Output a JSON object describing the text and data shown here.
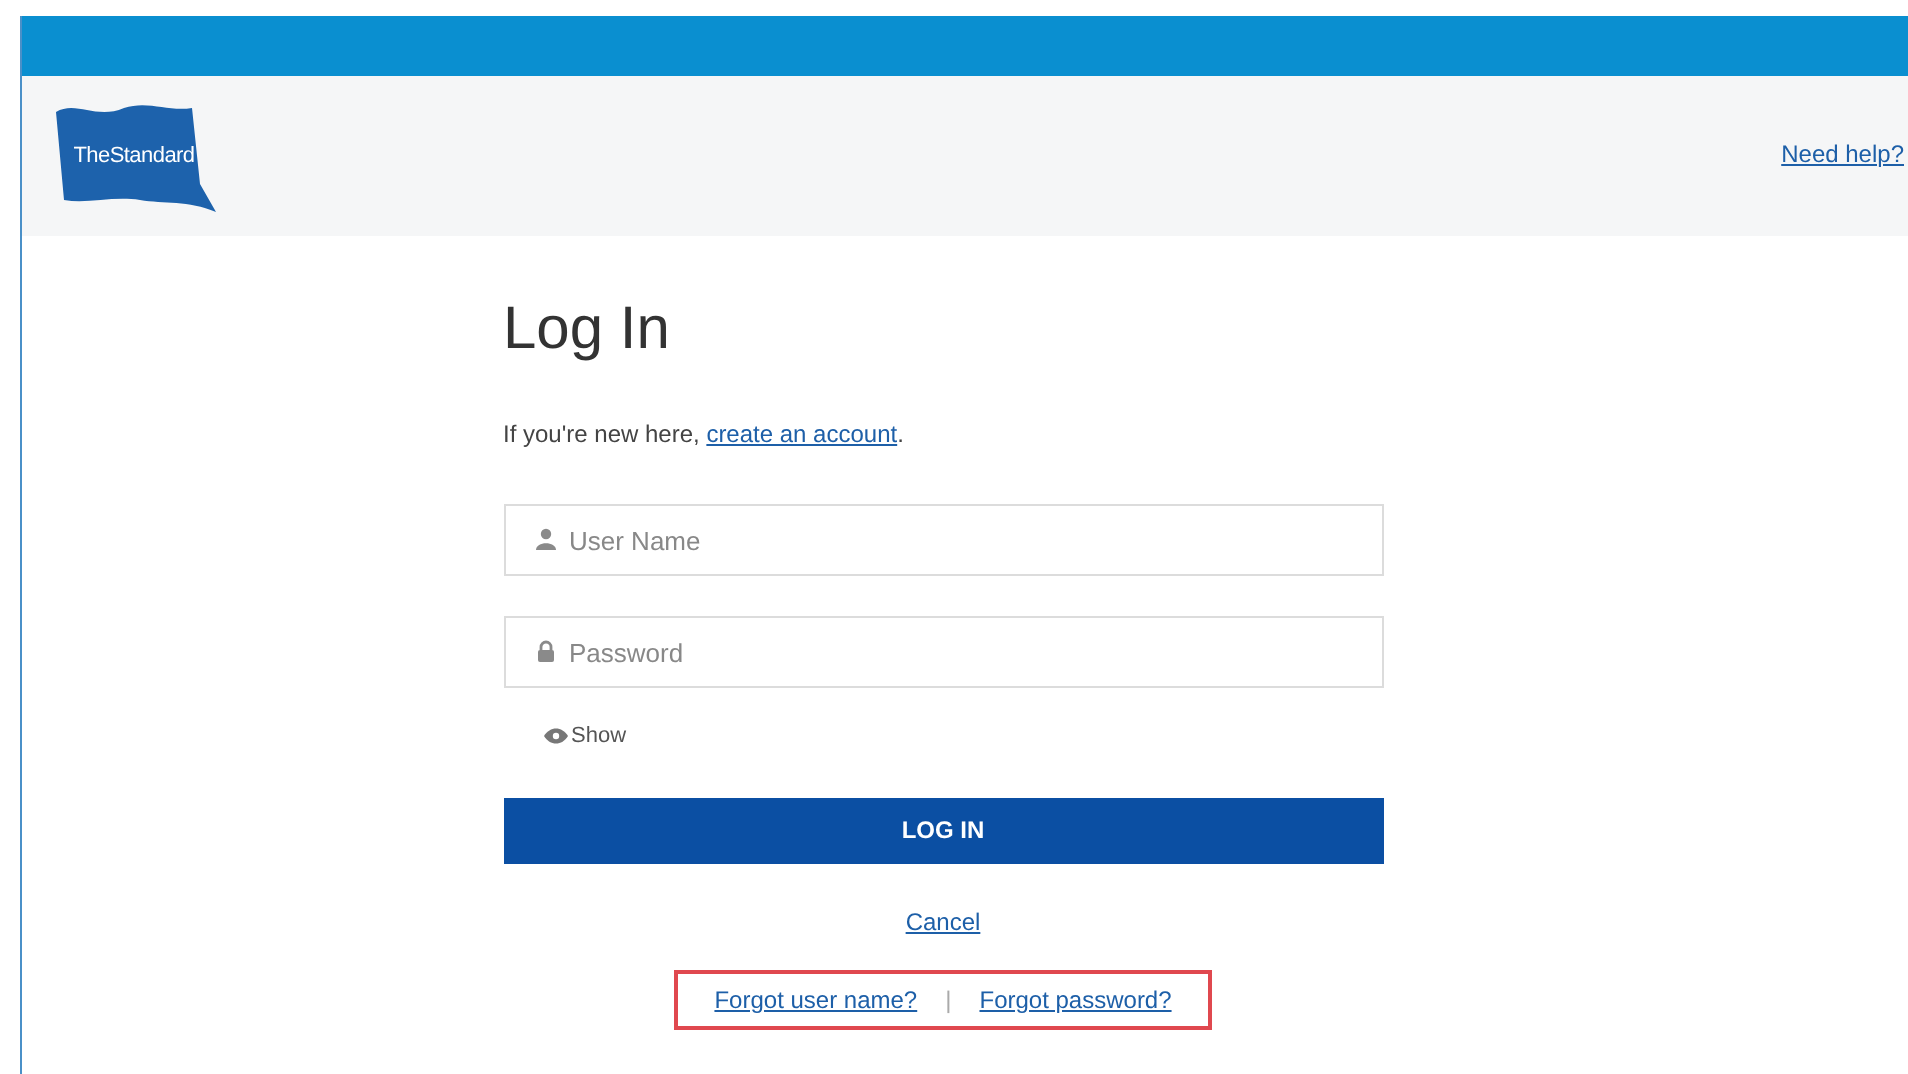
{
  "header": {
    "logo": "TheStandard",
    "help_link": "Need help?"
  },
  "login": {
    "title": "Log In",
    "intro": {
      "text": "If you're new here, ",
      "link": "create an account",
      "end": "."
    },
    "fields": [
      {
        "kind": "user",
        "placeholder": "User Name"
      },
      {
        "kind": "lock",
        "placeholder": "Password"
      }
    ],
    "show_toggle": "Show",
    "submit": "LOG IN",
    "cancel": "Cancel",
    "recovery": {
      "highlighted": true,
      "links": [
        "Forgot user name?",
        "Forgot password?"
      ],
      "separator": "|"
    }
  }
}
